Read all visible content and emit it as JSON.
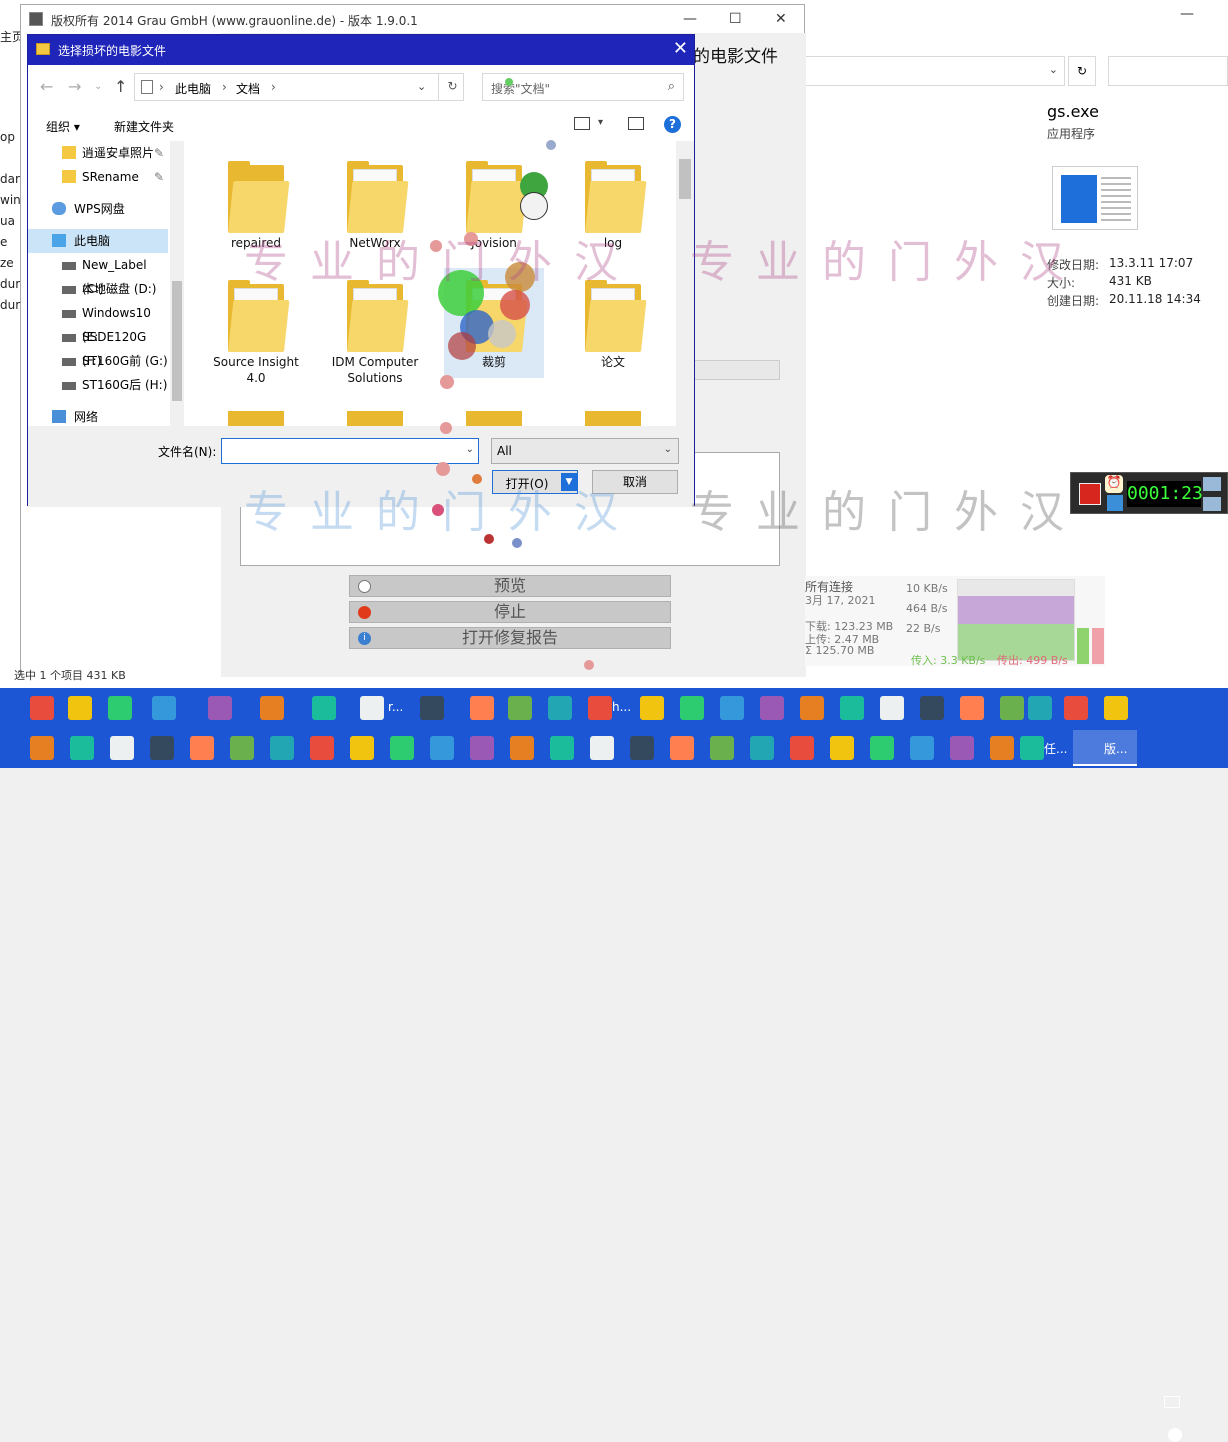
{
  "bg_explorer": {
    "details": {
      "file_name": "gs.exe",
      "file_type": "应用程序",
      "properties": [
        {
          "label": "修改日期:",
          "value": "13.3.11 17:07"
        },
        {
          "label": "大小:",
          "value": "431 KB"
        },
        {
          "label": "创建日期:",
          "value": "20.11.18 14:34"
        }
      ]
    },
    "edge_text": [
      "主页",
      "op",
      "dar",
      "win",
      "ua",
      "e",
      "ze",
      "dum",
      "dum"
    ],
    "status_text": "选中 1 个项目  431 KB"
  },
  "app": {
    "title": "版权所有 2014 Grau GmbH (www.grauonline.de) - 版本 1.9.0.1",
    "heading_tail": "的电影文件",
    "buttons": {
      "preview": "预览",
      "stop": "停止",
      "open_report": "打开修复报告"
    }
  },
  "network_monitor": {
    "label": "所有连接",
    "date": "3月 17, 2021",
    "download": "下载: 123.23 MB",
    "upload": "上传: 2.47 MB",
    "total": "Σ 125.70 MB",
    "scale": [
      "10 KB/s",
      "464 B/s",
      "22 B/s"
    ],
    "in_rate": "传入: 3.3 KB/s",
    "out_rate": "传出: 499 B/s"
  },
  "recorder": {
    "time": "0001:23"
  },
  "dialog": {
    "title": "选择损坏的电影文件",
    "breadcrumb": [
      "此电脑",
      "文档"
    ],
    "search_placeholder": "搜索\"文档\"",
    "toolbar": {
      "organize": "组织 ▾",
      "new_folder": "新建文件夹"
    },
    "nav_items": [
      {
        "label": "逍遥安卓照片",
        "pinned": true,
        "icon": "folder-icon"
      },
      {
        "label": "SRename",
        "pinned": true,
        "icon": "folder-icon"
      },
      {
        "label": "WPS网盘",
        "icon": "cloud-icon"
      },
      {
        "label": "此电脑",
        "icon": "computer-icon"
      },
      {
        "label": "New_Label (C:)",
        "icon": "drive-icon"
      },
      {
        "label": "本地磁盘 (D:)",
        "icon": "drive-icon"
      },
      {
        "label": "Windows10 (E:",
        "icon": "drive-icon"
      },
      {
        "label": "SSDE120G (F:)",
        "icon": "drive-icon"
      },
      {
        "label": "ST160G前 (G:)",
        "icon": "drive-icon"
      },
      {
        "label": "ST160G后 (H:)",
        "icon": "drive-icon"
      },
      {
        "label": "网络",
        "icon": "network-icon"
      }
    ],
    "folders": [
      {
        "label": "repaired"
      },
      {
        "label": "NetWorx"
      },
      {
        "label": "Jovision"
      },
      {
        "label": "log"
      },
      {
        "label": "Source Insight 4.0"
      },
      {
        "label": "IDM Computer Solutions"
      },
      {
        "label": "裁剪"
      },
      {
        "label": "论文"
      }
    ],
    "filename_label": "文件名(N):",
    "filename_value": "",
    "filetype": "All",
    "open_button": "打开(O)",
    "cancel_button": "取消"
  },
  "watermark": "专业的门外汉",
  "taskbar": {
    "row1_labels": [
      "r...",
      "h..."
    ],
    "row2_labels": [
      "任...",
      "版..."
    ],
    "colors": {
      "bar": "#1c56d4"
    }
  }
}
